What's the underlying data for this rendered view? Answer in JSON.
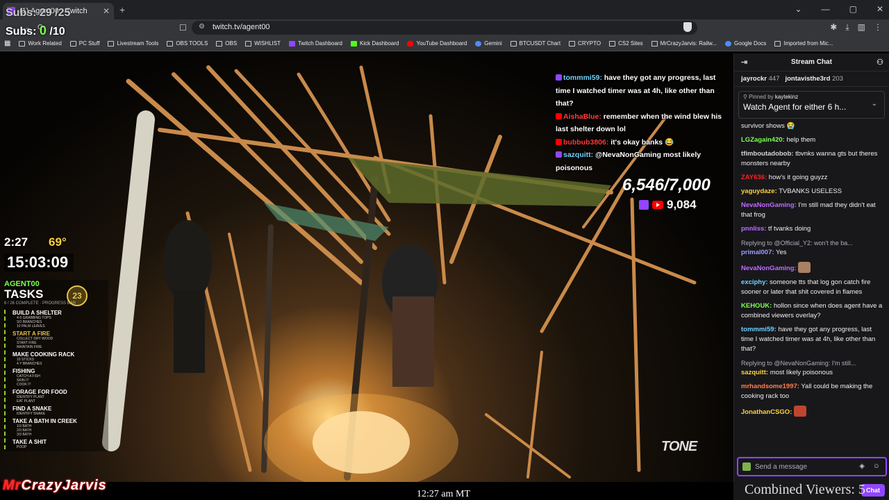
{
  "browser": {
    "tab_title": "(1) Agent00 - Twitch",
    "url": "twitch.tv/agent00",
    "bookmarks": [
      {
        "label": "Work Related",
        "icon": "folder-icon"
      },
      {
        "label": "PC Stuff",
        "icon": "folder-icon"
      },
      {
        "label": "Livestream Tools",
        "icon": "folder-icon"
      },
      {
        "label": "OBS TOOLS",
        "icon": "folder-icon"
      },
      {
        "label": "OBS",
        "icon": "folder-icon"
      },
      {
        "label": "WISHLIST",
        "icon": "folder-icon"
      },
      {
        "label": "Twitch Dashboard",
        "icon": "twitch-icon"
      },
      {
        "label": "Kick Dashboard",
        "icon": "kick-icon"
      },
      {
        "label": "YouTube Dashboard",
        "icon": "youtube-icon"
      },
      {
        "label": "Gemini",
        "icon": "gemini-icon"
      },
      {
        "label": "BTCUSDT Chart",
        "icon": "chart-icon"
      },
      {
        "label": "CRYPTO",
        "icon": "folder-icon"
      },
      {
        "label": "CS2 Sites",
        "icon": "folder-icon"
      },
      {
        "label": "MrCrazyJarvis: Railw...",
        "icon": "site-icon"
      },
      {
        "label": "Google Docs",
        "icon": "docs-icon"
      },
      {
        "label": "Imported from Mic...",
        "icon": "folder-icon"
      }
    ]
  },
  "overlay": {
    "subs_total": "Subs: 29 /25",
    "subs_label": "Subs:",
    "subs_current": "0",
    "subs_goal": "/10",
    "viewer_goal": "6,546/7,000",
    "viewer_total": "9,084",
    "timer": "2:27",
    "temperature": "69°",
    "clock_big": "15:03:09",
    "agent_label": "AGENT00",
    "tasks_title": "TASKS",
    "score": "23",
    "progress_text": "6 / 26 COMPLETE · PROGRESS BAR",
    "tasks": [
      {
        "name": "BUILD A SHELTER",
        "done": false,
        "subs": [
          "4-5 GRABBING TOPS",
          "SO BRANCHES",
          "10 PALM LEAVES"
        ]
      },
      {
        "name": "START A FIRE",
        "done": true,
        "subs": [
          "COLLECT DRY WOOD",
          "START FIRE",
          "MAINTAIN FIRE"
        ]
      },
      {
        "name": "MAKE COOKING RACK",
        "done": false,
        "subs": [
          "10 STICKS",
          "4 Y BRANCHES"
        ]
      },
      {
        "name": "FISHING",
        "done": false,
        "subs": [
          "CATCH A FISH",
          "SKIN IT",
          "COOK IT"
        ]
      },
      {
        "name": "FORAGE FOR FOOD",
        "done": false,
        "subs": [
          "IDENTIFY PLANT",
          "EAT PLANT"
        ]
      },
      {
        "name": "FIND A SNAKE",
        "done": false,
        "subs": [
          "IDENTIFY SNAKE"
        ]
      },
      {
        "name": "TAKE A BATH IN CREEK",
        "done": false,
        "subs": [
          "1/3 BATH",
          "2/3 BATH",
          "3/3 BATH"
        ]
      },
      {
        "name": "TAKE A SHIT",
        "done": false,
        "subs": [
          "POOP"
        ]
      }
    ],
    "brand_red": "Mr",
    "brand_white": "CrazyJarvis",
    "tone_logo": "TONE",
    "clock_bottom": "12:27 am MT",
    "combined_viewers": "Combined Viewers: 5",
    "chat": [
      {
        "user": "tommmi59:",
        "text": " have they got any progress, last time I watched timer was at 4h, like other than that?",
        "platform": "twitch"
      },
      {
        "user": "AishaBlue:",
        "text": " remember when the wind blew his last shelter down lol",
        "platform": "youtube"
      },
      {
        "user": "bubbub3806:",
        "text": " it's okay banks 😂",
        "platform": "youtube"
      },
      {
        "user": "sazquitt:",
        "text": " @NevaNonGaming most likely poisonous",
        "platform": "twitch"
      }
    ]
  },
  "chat_panel": {
    "title": "Stream Chat",
    "top_viewers": [
      {
        "name": "jayrockr",
        "count": "447"
      },
      {
        "name": "jontavisthe3rd",
        "count": "203"
      }
    ],
    "pinned_by_label": "Pinned by",
    "pinned_by": "kaytekinz",
    "pinned_text": "Watch Agent for either 6 h...",
    "messages": [
      {
        "user": "",
        "text": "survivor shows 😭",
        "color": "#efeff1"
      },
      {
        "user": "LGZagain420:",
        "text": " help them",
        "color": "#7dff4f"
      },
      {
        "user": "tfimboutadobob:",
        "text": " tbvnks wanna gts but theres monsters nearby",
        "color": "#d6d6d6"
      },
      {
        "user": "ZAY636:",
        "text": " how's it going guyzz",
        "color": "#ff2020"
      },
      {
        "user": "yaguydaze:",
        "text": " TVBANKS USELESS",
        "color": "#ffd23c"
      },
      {
        "user": "NevaNonGaming:",
        "text": " I'm still mad they didn't eat that frog",
        "color": "#bf6bff"
      },
      {
        "user": "pnnliss:",
        "text": " tf tvanks doing",
        "color": "#bf6bff"
      },
      {
        "user": "primal007:",
        "text": " Yes",
        "color": "#9d9dff",
        "reply": "Replying to @Official_Y2: won't the ba..."
      },
      {
        "user": "NevaNonGaming:",
        "text": "",
        "color": "#bf6bff",
        "emote": true
      },
      {
        "user": "exciphy:",
        "text": " someone tts that log gon catch fire sooner or later that shit covered in flames",
        "color": "#6fd3ff"
      },
      {
        "user": "KEHOUK:",
        "text": " hollon  since when does agent have a combined viewers overlay?",
        "color": "#7dff4f"
      },
      {
        "user": "tommmi59:",
        "text": " have they got any progress, last time I watched timer was at 4h, like other than that?",
        "color": "#6fd3ff"
      },
      {
        "user": "sazquitt:",
        "text": " most likely poisonous",
        "color": "#ffd23c",
        "reply": "Replying to @NevaNonGaming: I'm still..."
      },
      {
        "user": "mrhandsome1997:",
        "text": " Yall could be making the cooking rack too",
        "color": "#ff7f50"
      },
      {
        "user": "JonathanCSGO:",
        "text": "",
        "color": "#ffd23c",
        "emote": true
      }
    ],
    "input_placeholder": "Send a message",
    "chat_button": "Chat"
  }
}
